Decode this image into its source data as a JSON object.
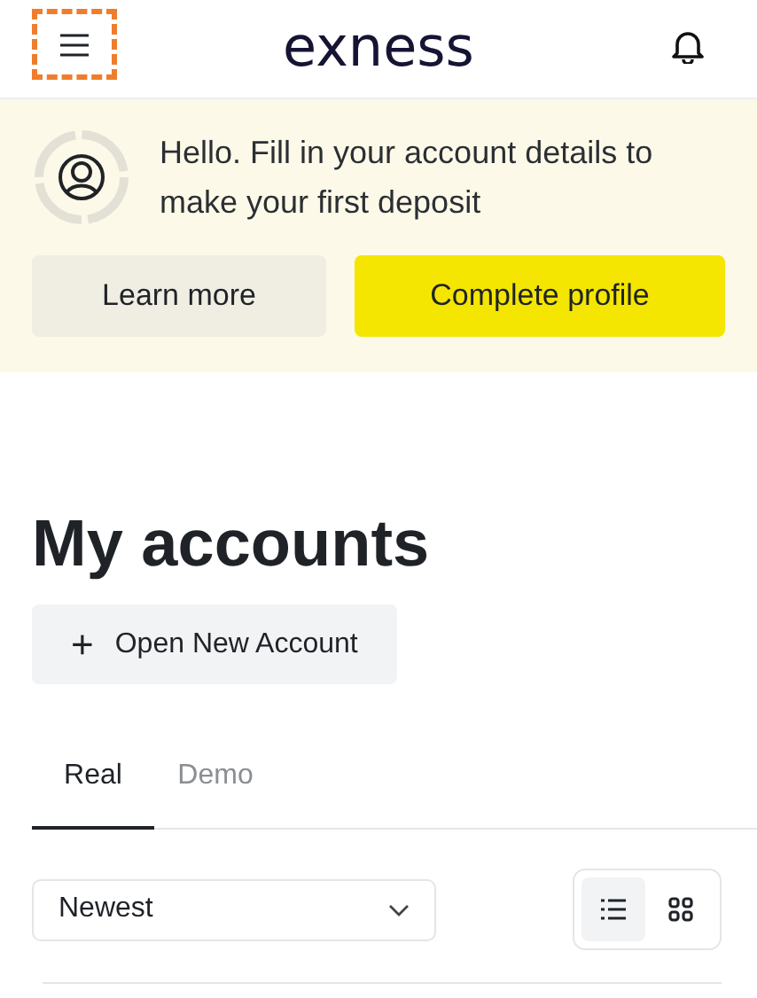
{
  "header": {
    "logo": "exness",
    "menu_highlighted": true
  },
  "banner": {
    "message": "Hello. Fill in your account details to make your first deposit",
    "buttons": [
      {
        "label": "Learn more",
        "kind": "secondary"
      },
      {
        "label": "Complete profile",
        "kind": "primary"
      }
    ]
  },
  "page_title": "My accounts",
  "open_account": {
    "icon": "+",
    "label": "Open New Account"
  },
  "tabs": [
    {
      "label": "Real",
      "selected": true
    },
    {
      "label": "Demo",
      "selected": false
    }
  ],
  "sort": {
    "value": "Newest"
  },
  "view_toggle": [
    {
      "kind": "list",
      "selected": true
    },
    {
      "kind": "grid",
      "selected": false
    }
  ]
}
